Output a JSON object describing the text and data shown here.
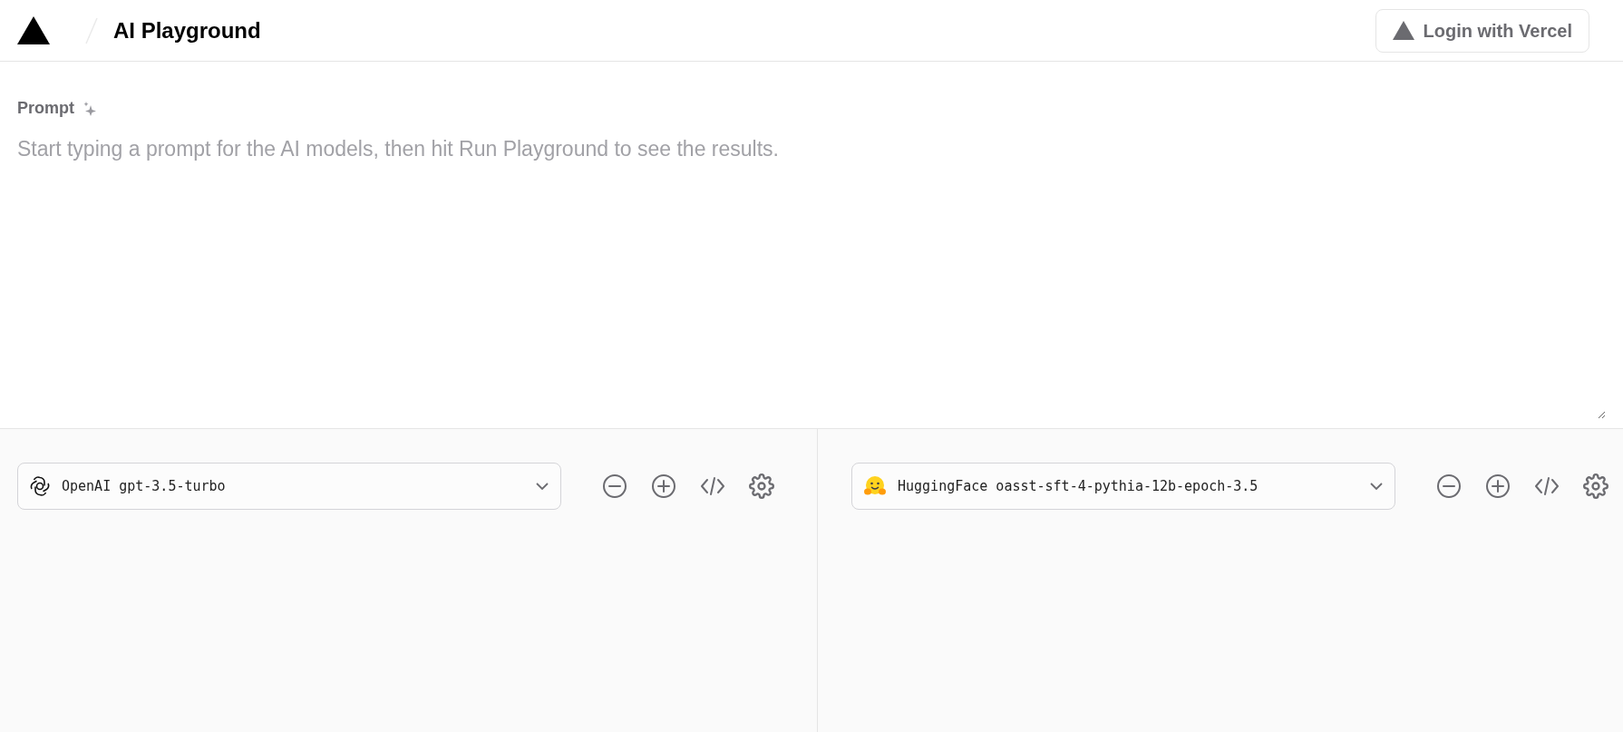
{
  "header": {
    "title": "AI Playground",
    "login_button": "Login with Vercel"
  },
  "prompt": {
    "label": "Prompt",
    "placeholder": "Start typing a prompt for the AI models, then hit Run Playground to see the results."
  },
  "models": [
    {
      "kind": "openai",
      "provider": "OpenAI",
      "model": "gpt-3.5-turbo"
    },
    {
      "kind": "huggingface",
      "provider": "HuggingFace",
      "model": "oasst-sft-4-pythia-12b-epoch-3.5"
    }
  ]
}
